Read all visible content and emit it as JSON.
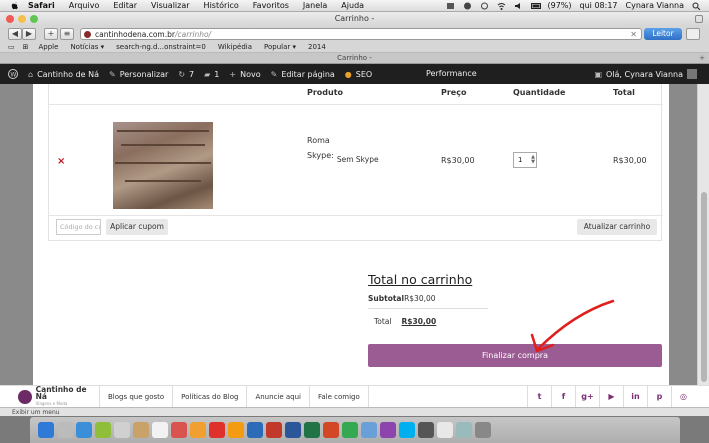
{
  "menubar": {
    "app": "Safari",
    "items": [
      "Arquivo",
      "Editar",
      "Visualizar",
      "Histórico",
      "Favoritos",
      "Janela",
      "Ajuda"
    ],
    "battery": "(97%)",
    "clock": "qui 08:17",
    "user": "Cynara Vianna"
  },
  "window": {
    "title": "Carrinho -",
    "tab_title": "Carrinho -"
  },
  "toolbar": {
    "url_domain": "cantinhodena.com.br",
    "url_path": "/carrinho/",
    "reader_label": "Leitor"
  },
  "bookmarks": [
    "Apple",
    "Notícias ▾",
    "search-ng.d...onstraint=0",
    "Wikipédia",
    "Popular ▾",
    "2014"
  ],
  "adminbar": {
    "site": "Cantinho de Ná",
    "customize": "Personalizar",
    "updates": "7",
    "comments": "1",
    "new": "Novo",
    "edit": "Editar página",
    "seo": "SEO",
    "performance": "Performance",
    "greeting": "Olá, Cynara Vianna"
  },
  "cart": {
    "headers": {
      "product": "Produto",
      "price": "Preço",
      "quantity": "Quantidade",
      "total": "Total"
    },
    "item": {
      "remove": "×",
      "name": "Roma",
      "meta_label": "Skype:",
      "meta_value": "Sem Skype",
      "price": "R$30,00",
      "quantity": "1",
      "subtotal": "R$30,00"
    },
    "coupon_placeholder": "Código do cupom",
    "apply_coupon": "Aplicar cupom",
    "update_cart": "Atualizar carrinho"
  },
  "totals": {
    "title": "Total no carrinho",
    "subtotal_label": "Subtotal",
    "subtotal_value": "R$30,00",
    "total_label": "Total",
    "total_value": "R$30,00",
    "checkout": "Finalizar compra"
  },
  "footer": {
    "logo_title": "Cantinho de Ná",
    "logo_sub": "Viagens e Moda",
    "links": [
      "Blogs que gosto",
      "Políticas do Blog",
      "Anuncie aqui",
      "Fale comigo"
    ],
    "social": [
      "twitter-icon",
      "facebook-icon",
      "google-plus-icon",
      "youtube-icon",
      "linkedin-icon",
      "pinterest-icon",
      "instagram-icon"
    ],
    "status": "Exibir um menu"
  },
  "colors": {
    "checkout": "#9b5c93",
    "adminbar": "#1f1f1f",
    "remove": "#c4121c",
    "reader": "#3f86d8"
  }
}
